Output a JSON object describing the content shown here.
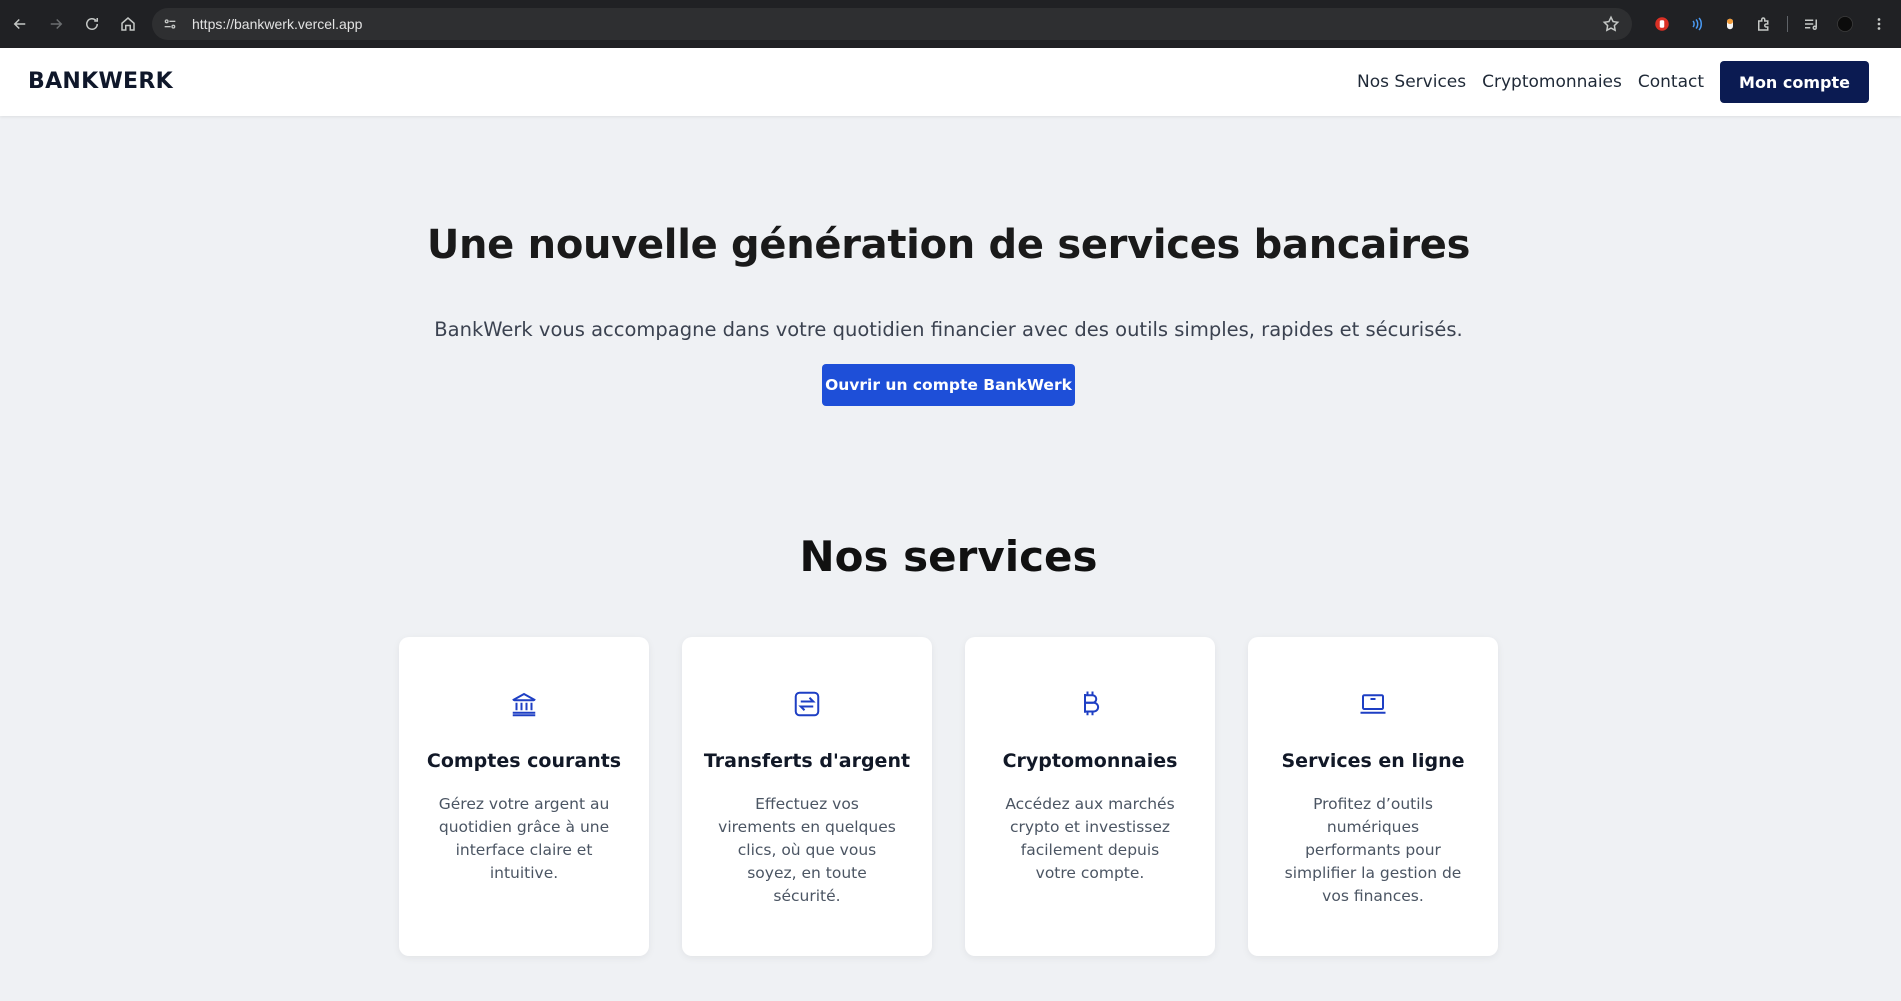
{
  "browser": {
    "url": "https://bankwerk.vercel.app",
    "icons": [
      "back-icon",
      "forward-icon",
      "reload-icon",
      "home-icon",
      "site-info-icon",
      "bookmark-star-icon",
      "extension-red-icon",
      "extension-wave-icon",
      "extension-capsule-icon",
      "extensions-puzzle-icon",
      "media-queue-icon",
      "profile-avatar-icon"
    ]
  },
  "header": {
    "logo": "BANKWERK",
    "nav": [
      "Nos Services",
      "Cryptomonnaies",
      "Contact"
    ],
    "account_button": "Mon compte"
  },
  "hero": {
    "title": "Une nouvelle génération de services bancaires",
    "subtitle": "BankWerk vous accompagne dans votre quotidien financier avec des outils simples, rapides et sécurisés.",
    "cta": "Ouvrir un compte BankWerk"
  },
  "services": {
    "title": "Nos services",
    "cards": [
      {
        "icon": "bank-icon",
        "title": "Comptes courants",
        "text": "Gérez votre argent au quotidien grâce à une interface claire et intuitive."
      },
      {
        "icon": "transfer-icon",
        "title": "Transferts d'argent",
        "text": "Effectuez vos virements en quelques clics, où que vous soyez, en toute sécurité."
      },
      {
        "icon": "bitcoin-icon",
        "title": "Cryptomonnaies",
        "text": "Accédez aux marchés crypto et investissez facilement depuis votre compte."
      },
      {
        "icon": "laptop-icon",
        "title": "Services en ligne",
        "text": "Profitez d’outils numériques performants pour simplifier la gestion de vos finances."
      }
    ]
  },
  "colors": {
    "page_bg": "#eff1f4",
    "brand_navy": "#0b1b52",
    "accent_blue": "#1e4fd8",
    "icon_blue": "#1e3fc4"
  }
}
